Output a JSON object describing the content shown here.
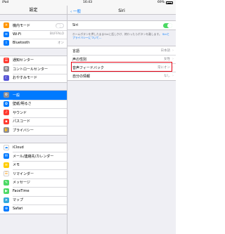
{
  "status_bar": {
    "device": "iPad",
    "time": "16:43",
    "battery": "69%"
  },
  "left": {
    "title": "設定",
    "groups": [
      [
        {
          "label": "機内モード",
          "icon": "airplane-icon",
          "color": "#ff9500",
          "glyph": "✈",
          "type": "toggle-off"
        },
        {
          "label": "Wi-Fi",
          "icon": "wifi-icon",
          "color": "#007aff",
          "glyph": "≋",
          "value": "BUFFALO"
        },
        {
          "label": "Bluetooth",
          "icon": "bluetooth-icon",
          "color": "#007aff",
          "glyph": "ᛒ",
          "value": "オン"
        }
      ],
      [
        {
          "label": "通知センター",
          "icon": "notification-center-icon",
          "color": "#ff3b30",
          "glyph": "☰"
        },
        {
          "label": "コントロールセンター",
          "icon": "control-center-icon",
          "color": "#8e8e93",
          "glyph": "⚙"
        },
        {
          "label": "おやすみモード",
          "icon": "do-not-disturb-icon",
          "color": "#5856d6",
          "glyph": "☾"
        }
      ],
      [
        {
          "label": "一般",
          "icon": "gear-icon",
          "color": "#8e8e93",
          "glyph": "⚙",
          "selected": true
        },
        {
          "label": "壁紙/明るさ",
          "icon": "wallpaper-icon",
          "color": "#007aff",
          "glyph": "✿"
        },
        {
          "label": "サウンド",
          "icon": "sound-icon",
          "color": "#ff3b30",
          "glyph": "♪"
        },
        {
          "label": "パスコード",
          "icon": "passcode-icon",
          "color": "#ff3b30",
          "glyph": "▪"
        },
        {
          "label": "プライバシー",
          "icon": "privacy-hand-icon",
          "color": "#8e8e93",
          "glyph": "✋"
        }
      ],
      [
        {
          "label": "iCloud",
          "icon": "icloud-icon",
          "color": "#ffffff",
          "glyph": "☁",
          "glyph_color": "#007aff"
        },
        {
          "label": "メール/連絡先/カレンダー",
          "icon": "mail-icon",
          "color": "#007aff",
          "glyph": "✉"
        },
        {
          "label": "メモ",
          "icon": "notes-icon",
          "color": "#ffcc00",
          "glyph": "≡"
        },
        {
          "label": "リマインダー",
          "icon": "reminders-icon",
          "color": "#ffffff",
          "glyph": "☰",
          "glyph_color": "#ff9500"
        },
        {
          "label": "メッセージ",
          "icon": "messages-icon",
          "color": "#4cd964",
          "glyph": "✎"
        },
        {
          "label": "FaceTime",
          "icon": "facetime-icon",
          "color": "#4cd964",
          "glyph": "▶"
        },
        {
          "label": "マップ",
          "icon": "maps-icon",
          "color": "#34aadc",
          "glyph": "➤"
        },
        {
          "label": "Safari",
          "icon": "safari-icon",
          "color": "#007aff",
          "glyph": "⊕"
        }
      ]
    ]
  },
  "right": {
    "back_label": "一般",
    "title": "Siri",
    "siri_label": "Siri",
    "siri_enabled": true,
    "note_text": "ホームボタンを押したままSiriに話しかけ、終わったらボタンを離します。",
    "note_link": "Siriとプライバシーについて…",
    "rows": [
      {
        "label": "言語",
        "value": "日本語"
      },
      {
        "label": "声の性別",
        "value": "女性",
        "highlighted": true
      },
      {
        "label": "音声フィードバック",
        "value": "常にオン"
      },
      {
        "label": "自分の情報",
        "value": "なし"
      }
    ],
    "accent": "#007aff",
    "highlight_color": "#e60012"
  }
}
